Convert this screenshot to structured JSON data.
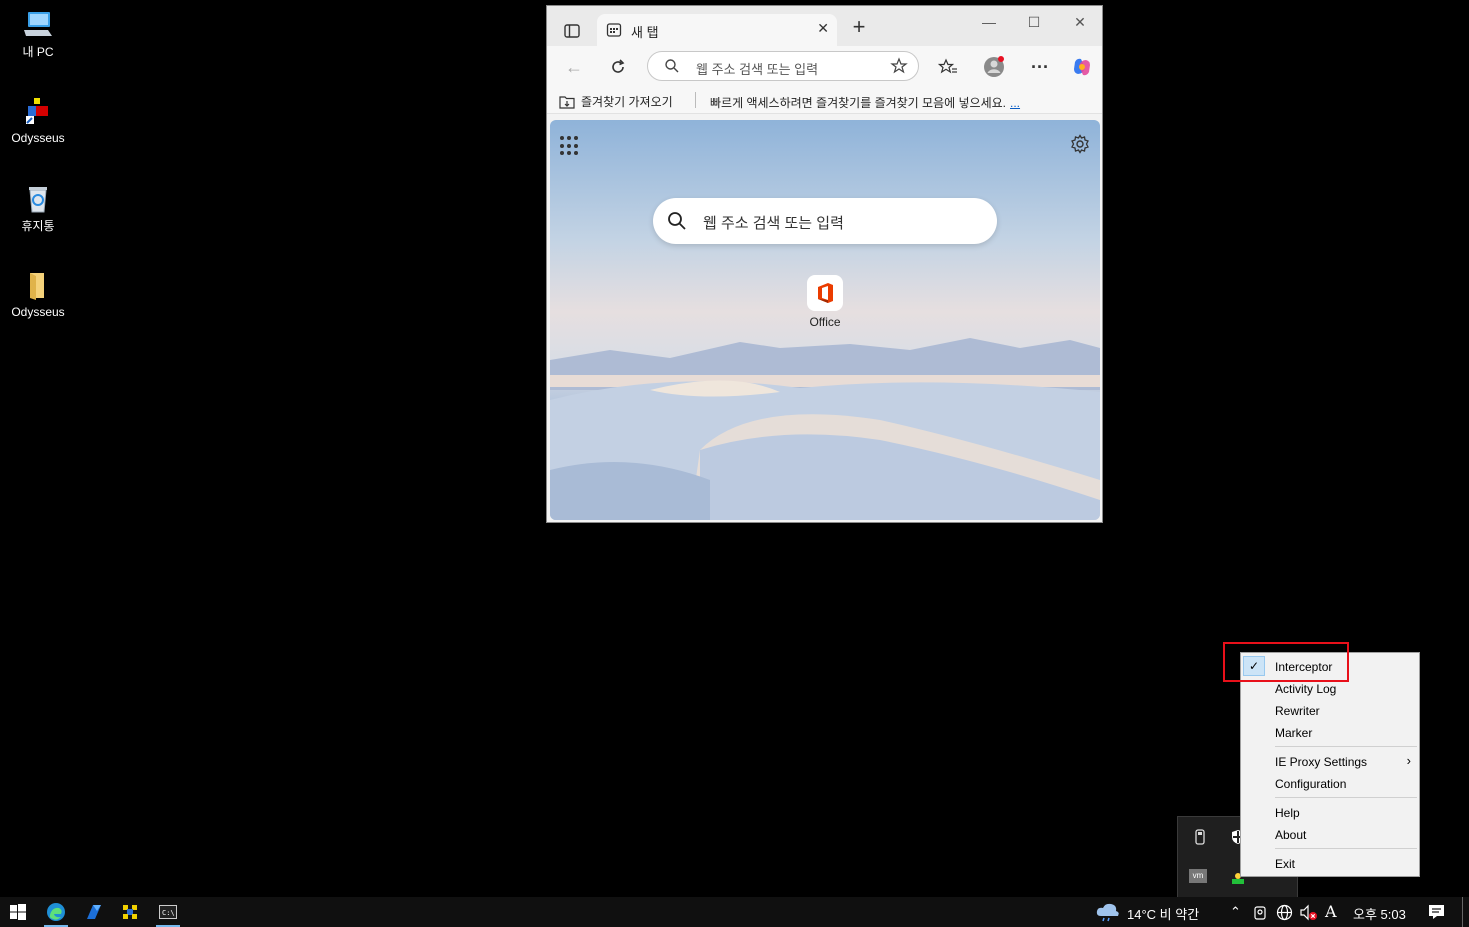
{
  "desktop": {
    "icons": [
      {
        "label": "내 PC",
        "icon": "computer-icon"
      },
      {
        "label": "Odysseus",
        "icon": "odysseus-app-icon"
      },
      {
        "label": "휴지통",
        "icon": "recycle-bin-icon"
      },
      {
        "label": "Odysseus",
        "icon": "folder-icon"
      }
    ]
  },
  "browser": {
    "tab_title": "새 탭",
    "address_placeholder": "웹 주소 검색 또는 입력",
    "favorites_import": "즐겨찾기 가져오기",
    "favorites_hint": "빠르게 액세스하려면 즐겨찾기를 즐겨찾기 모음에 넣으세요.",
    "favorites_more": "...",
    "ntp_search_placeholder": "웹 주소 검색 또는 입력",
    "tile_label": "Office"
  },
  "context_menu": {
    "items": [
      {
        "label": "Interceptor",
        "checked": true
      },
      {
        "label": "Activity Log"
      },
      {
        "label": "Rewriter"
      },
      {
        "label": "Marker"
      },
      {
        "label": "IE Proxy Settings",
        "submenu": true
      },
      {
        "label": "Configuration"
      },
      {
        "label": "Help"
      },
      {
        "label": "About"
      },
      {
        "label": "Exit"
      }
    ]
  },
  "taskbar": {
    "weather": "14°C  비 약간",
    "clock": "오후 5:03",
    "ime": "A"
  },
  "colors": {
    "highlight_border": "#e8101a",
    "accent": "#0a5cc2"
  }
}
